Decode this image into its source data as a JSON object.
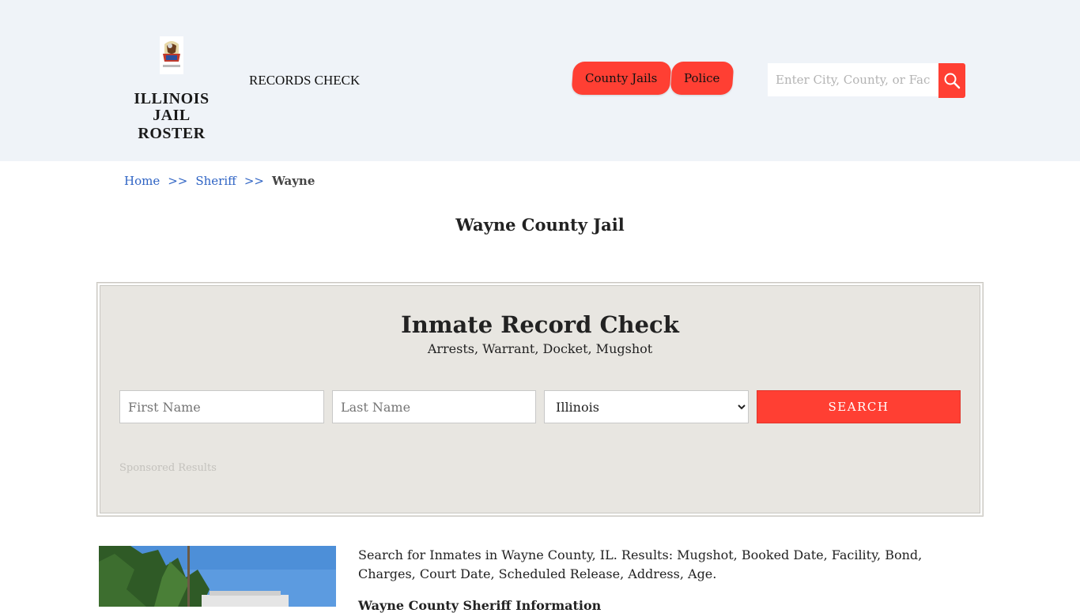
{
  "header": {
    "logo": {
      "line1": "ILLINOIS",
      "line2": "JAIL ROSTER",
      "motto": "••• "
    },
    "records_link": "RECORDS CHECK",
    "nav": [
      {
        "label": "County Jails"
      },
      {
        "label": "Police"
      }
    ],
    "search": {
      "placeholder": "Enter City, County, or Facility"
    }
  },
  "breadcrumb": {
    "home": "Home",
    "sep": ">>",
    "sheriff": "Sheriff",
    "current": "Wayne"
  },
  "page_title": "Wayne County Jail",
  "record_check": {
    "title": "Inmate Record Check",
    "subtitle": "Arrests, Warrant, Docket, Mugshot",
    "first_name_placeholder": "First Name",
    "last_name_placeholder": "Last Name",
    "state_selected": "Illinois",
    "search_label": "SEARCH",
    "sponsored_label": "Sponsored Results"
  },
  "content": {
    "intro": "Search for Inmates in Wayne County, IL. Results: Mugshot, Booked Date, Facility, Bond, Charges, Court Date, Scheduled Release, Address, Age.",
    "subhead": "Wayne County Sheriff Information"
  },
  "colors": {
    "accent": "#ff3f33",
    "header_bg": "#eff3f8",
    "panel_bg": "#e8e6e1",
    "link": "#2e63c4"
  }
}
